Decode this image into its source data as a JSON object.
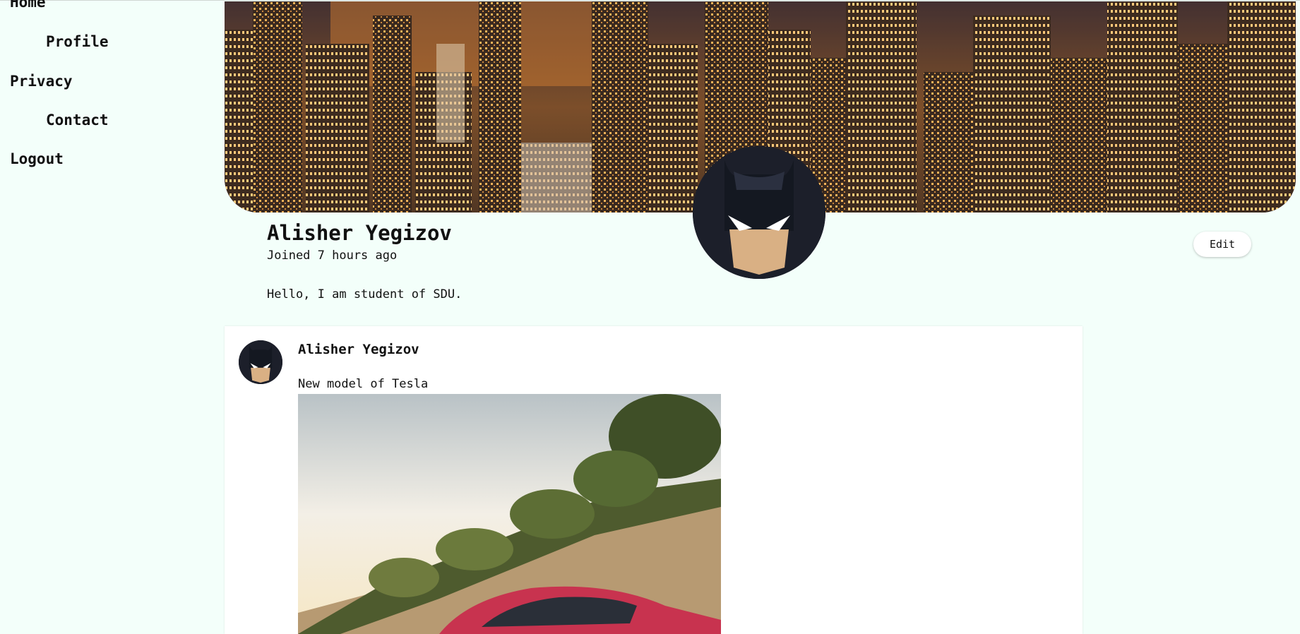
{
  "sidebar": {
    "items": [
      {
        "label": "Home"
      },
      {
        "label": "Profile"
      },
      {
        "label": "Privacy"
      },
      {
        "label": "Contact"
      },
      {
        "label": "Logout"
      }
    ]
  },
  "profile": {
    "name": "Alisher Yegizov",
    "joined": "Joined 7 hours ago",
    "bio": "Hello, I am student of SDU.",
    "edit_label": "Edit",
    "avatar_icon": "batman-avatar-icon",
    "cover_image": "city-skyline-night"
  },
  "post": {
    "author": "Alisher Yegizov",
    "text": "New model of Tesla",
    "image": "red-tesla-car-hillside"
  }
}
